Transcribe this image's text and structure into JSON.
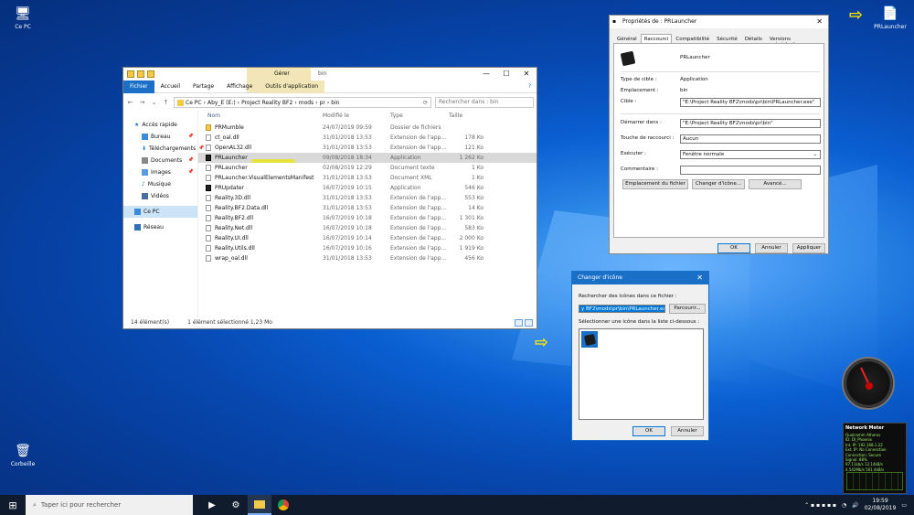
{
  "desktop": {
    "icons": [
      {
        "label": "Ce PC",
        "icon": "computer-icon"
      },
      {
        "label": "Corbeille",
        "icon": "recycle-bin-icon"
      },
      {
        "label": "PRLauncher",
        "icon": "file-icon"
      }
    ]
  },
  "explorer": {
    "tab_group_label": "Gérer",
    "window_title": "bin",
    "ribbon_tabs": [
      "Fichier",
      "Accueil",
      "Partage",
      "Affichage",
      "Outils d'application"
    ],
    "path": [
      "Ce PC",
      "Aby_E (E:)",
      "Project Reality BF2",
      "mods",
      "pr",
      "bin"
    ],
    "search_placeholder": "Rechercher dans : bin",
    "nav": [
      {
        "label": "Accès rapide",
        "pinned": false,
        "indent": false
      },
      {
        "label": "Bureau",
        "pinned": true,
        "indent": true
      },
      {
        "label": "Téléchargements",
        "pinned": true,
        "indent": true
      },
      {
        "label": "Documents",
        "pinned": true,
        "indent": true
      },
      {
        "label": "Images",
        "pinned": true,
        "indent": true
      },
      {
        "label": "Musique",
        "pinned": false,
        "indent": true
      },
      {
        "label": "Vidéos",
        "pinned": false,
        "indent": true
      },
      {
        "label": "Ce PC",
        "pinned": false,
        "indent": false,
        "selected": true
      },
      {
        "label": "Réseau",
        "pinned": false,
        "indent": false
      }
    ],
    "columns": [
      "Nom",
      "Modifié le",
      "Type",
      "Taille"
    ],
    "files": [
      {
        "name": "PRMumble",
        "date": "24/07/2019 09:59",
        "type": "Dossier de fichiers",
        "size": "",
        "kind": "folder"
      },
      {
        "name": "ct_oal.dll",
        "date": "31/01/2018 13:53",
        "type": "Extension de l'app...",
        "size": "178 Ko",
        "kind": "file"
      },
      {
        "name": "OpenAL32.dll",
        "date": "31/01/2018 13:53",
        "type": "Extension de l'app...",
        "size": "121 Ko",
        "kind": "file"
      },
      {
        "name": "PRLauncher",
        "date": "09/08/2018 18:34",
        "type": "Application",
        "size": "1 262 Ko",
        "kind": "app",
        "selected": true
      },
      {
        "name": "PRLauncher",
        "date": "02/08/2019 12:29",
        "type": "Document texte",
        "size": "1 Ko",
        "kind": "file"
      },
      {
        "name": "PRLauncher.VisualElementsManifest",
        "date": "31/01/2018 13:53",
        "type": "Document XML",
        "size": "1 Ko",
        "kind": "file"
      },
      {
        "name": "PRUpdater",
        "date": "16/07/2019 10:15",
        "type": "Application",
        "size": "546 Ko",
        "kind": "app"
      },
      {
        "name": "Reality.3D.dll",
        "date": "31/01/2018 13:53",
        "type": "Extension de l'app...",
        "size": "553 Ko",
        "kind": "file"
      },
      {
        "name": "Reality.BF2.Data.dll",
        "date": "31/01/2018 13:53",
        "type": "Extension de l'app...",
        "size": "14 Ko",
        "kind": "file"
      },
      {
        "name": "Reality.BF2.dll",
        "date": "16/07/2019 10:18",
        "type": "Extension de l'app...",
        "size": "1 301 Ko",
        "kind": "file"
      },
      {
        "name": "Reality.Net.dll",
        "date": "16/07/2019 10:18",
        "type": "Extension de l'app...",
        "size": "583 Ko",
        "kind": "file"
      },
      {
        "name": "Reality.UI.dll",
        "date": "16/07/2019 10:14",
        "type": "Extension de l'app...",
        "size": "2 000 Ko",
        "kind": "file"
      },
      {
        "name": "Reality.Utils.dll",
        "date": "16/07/2019 10:16",
        "type": "Extension de l'app...",
        "size": "1 919 Ko",
        "kind": "file"
      },
      {
        "name": "wrap_oal.dll",
        "date": "31/01/2018 13:53",
        "type": "Extension de l'app...",
        "size": "456 Ko",
        "kind": "file"
      }
    ],
    "status_count": "14 élément(s)",
    "status_selection": "1 élément sélectionné  1,23 Mo"
  },
  "properties": {
    "title": "Propriétés de : PRLauncher",
    "tabs": [
      "Général",
      "Raccourci",
      "Compatibilité",
      "Sécurité",
      "Détails",
      "Versions précédentes"
    ],
    "active_tab": "Raccourci",
    "name": "PRLauncher",
    "target_type_label": "Type de cible :",
    "target_type": "Application",
    "location_label": "Emplacement :",
    "location": "bin",
    "target_label": "Cible :",
    "target": "\"E:\\Project Reality BF2\\mods\\pr\\bin\\PRLauncher.exe\"",
    "start_in_label": "Démarrer dans :",
    "start_in": "\"E:\\Project Reality BF2\\mods\\pr\\bin\"",
    "shortcut_key_label": "Touche de raccourci :",
    "shortcut_key": "Aucun",
    "run_label": "Exécuter :",
    "run": "Fenêtre normale",
    "comment_label": "Commentaire :",
    "comment": "",
    "btn_location": "Emplacement du fichier",
    "btn_change_icon": "Changer d'icône...",
    "btn_advanced": "Avancé...",
    "btn_ok": "OK",
    "btn_cancel": "Annuler",
    "btn_apply": "Appliquer"
  },
  "change_icon": {
    "title": "Changer d'icône",
    "search_label": "Rechercher des icônes dans ce fichier :",
    "path": "y BF2\\mods\\pr\\bin\\PRLauncher.exe",
    "browse": "Parcourir...",
    "select_label": "Sélectionner une icône dans la liste ci-dessous :",
    "btn_ok": "OK",
    "btn_cancel": "Annuler"
  },
  "network_meter": {
    "title": "Network Meter",
    "lines": [
      "Qualcomm Atheros",
      "ID: DI_Phoenix",
      "Int. IP: 192.168.1.22",
      "Ext. IP: No Connection",
      "Connection: Secure",
      "Signal: 88%"
    ],
    "up": "97.11kb/s",
    "up_total": "12.14kB/s",
    "down": "4.542Mb/s",
    "down_total": "561.4kB/s"
  },
  "taskbar": {
    "search_placeholder": "Taper ici pour rechercher",
    "time": "19:59",
    "date": "02/08/2019"
  }
}
